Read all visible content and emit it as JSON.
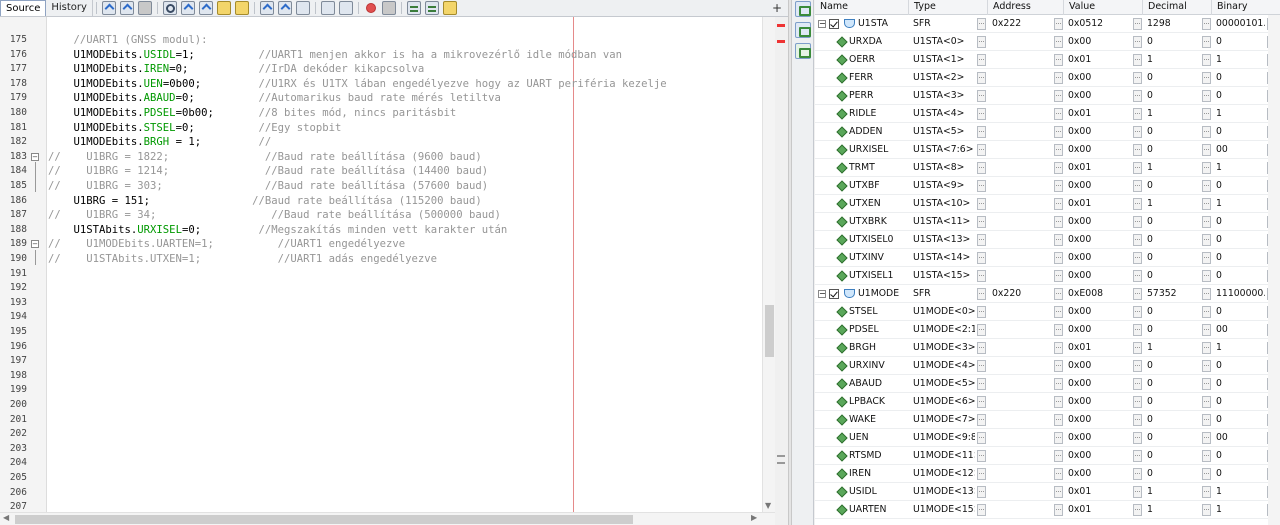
{
  "editor": {
    "tabs": [
      {
        "label": "Source",
        "active": true
      },
      {
        "label": "History",
        "active": false
      }
    ],
    "lines": [
      {
        "n": "175",
        "seg": [
          [
            "",
            "    "
          ],
          [
            "cm",
            "//UART1 (GNSS modul):"
          ]
        ]
      },
      {
        "n": "176",
        "seg": [
          [
            "",
            "    U1MODEbits."
          ],
          [
            "fld",
            "USIDL"
          ],
          [
            "",
            "=1;          "
          ],
          [
            "cm",
            "//UART1 menjen akkor is ha a mikrovezérlő idle módban van"
          ]
        ]
      },
      {
        "n": "177",
        "seg": [
          [
            "",
            "    U1MODEbits."
          ],
          [
            "fld",
            "IREN"
          ],
          [
            "",
            "=0;           "
          ],
          [
            "cm",
            "//IrDA dekóder kikapcsolva"
          ]
        ]
      },
      {
        "n": "178",
        "seg": [
          [
            "",
            "    U1MODEbits."
          ],
          [
            "fld",
            "UEN"
          ],
          [
            "",
            "=0b00;         "
          ],
          [
            "cm",
            "//U1RX és U1TX lában engedélyezve hogy az UART periféria kezelje"
          ]
        ]
      },
      {
        "n": "179",
        "seg": [
          [
            "",
            "    U1MODEbits."
          ],
          [
            "fld",
            "ABAUD"
          ],
          [
            "",
            "=0;          "
          ],
          [
            "cm",
            "//Automarikus baud rate mérés letiltva"
          ]
        ]
      },
      {
        "n": "180",
        "seg": [
          [
            "",
            "    U1MODEbits."
          ],
          [
            "fld",
            "PDSEL"
          ],
          [
            "",
            "=0b00;       "
          ],
          [
            "cm",
            "//8 bites mód, nincs paritásbit"
          ]
        ]
      },
      {
        "n": "181",
        "seg": [
          [
            "",
            "    U1MODEbits."
          ],
          [
            "fld",
            "STSEL"
          ],
          [
            "",
            "=0;          "
          ],
          [
            "cm",
            "//Egy stopbit"
          ]
        ]
      },
      {
        "n": "182",
        "seg": [
          [
            "",
            "    U1MODEbits."
          ],
          [
            "fld",
            "BRGH"
          ],
          [
            "",
            " = 1;         "
          ],
          [
            "cm",
            "//"
          ]
        ]
      },
      {
        "n": "183",
        "seg": [
          [
            "cm",
            "//    U1BRG = 1822;               //Baud rate beállítása (9600 baud)"
          ]
        ]
      },
      {
        "n": "184",
        "seg": [
          [
            "cm",
            "//    U1BRG = 1214;               //Baud rate beállítása (14400 baud)"
          ]
        ]
      },
      {
        "n": "185",
        "seg": [
          [
            "cm",
            "//    U1BRG = 303;                //Baud rate beállítása (57600 baud)"
          ]
        ]
      },
      {
        "n": "186",
        "seg": [
          [
            "",
            "    U1BRG = 151;                "
          ],
          [
            "cm",
            "//Baud rate beállítása (115200 baud)"
          ]
        ]
      },
      {
        "n": "187",
        "seg": [
          [
            "cm",
            "//    U1BRG = 34;                  //Baud rate beállítása (500000 baud)"
          ]
        ]
      },
      {
        "n": "188",
        "seg": [
          [
            "",
            "    U1STAbits."
          ],
          [
            "fld",
            "URXISEL"
          ],
          [
            "",
            "=0;         "
          ],
          [
            "cm",
            "//Megszakítás minden vett karakter után"
          ]
        ]
      },
      {
        "n": "189",
        "seg": [
          [
            "cm",
            "//    U1MODEbits.UARTEN=1;          //UART1 engedélyezve"
          ]
        ]
      },
      {
        "n": "190",
        "seg": [
          [
            "cm",
            "//    U1STAbits.UTXEN=1;            //UART1 adás engedélyezve"
          ]
        ]
      },
      {
        "n": "191",
        "seg": [
          [
            "",
            ""
          ]
        ]
      },
      {
        "n": "192",
        "seg": [
          [
            "",
            ""
          ]
        ]
      },
      {
        "n": "193",
        "seg": [
          [
            "",
            ""
          ]
        ]
      },
      {
        "n": "194",
        "seg": [
          [
            "",
            ""
          ]
        ]
      },
      {
        "n": "195",
        "seg": [
          [
            "",
            ""
          ]
        ]
      },
      {
        "n": "196",
        "seg": [
          [
            "",
            ""
          ]
        ]
      },
      {
        "n": "197",
        "seg": [
          [
            "",
            ""
          ]
        ]
      },
      {
        "n": "198",
        "seg": [
          [
            "",
            ""
          ]
        ]
      },
      {
        "n": "199",
        "seg": [
          [
            "",
            ""
          ]
        ]
      },
      {
        "n": "200",
        "seg": [
          [
            "",
            ""
          ]
        ]
      },
      {
        "n": "201",
        "seg": [
          [
            "",
            ""
          ]
        ]
      },
      {
        "n": "202",
        "seg": [
          [
            "",
            ""
          ]
        ]
      },
      {
        "n": "203",
        "seg": [
          [
            "",
            ""
          ]
        ]
      },
      {
        "n": "204",
        "seg": [
          [
            "",
            ""
          ]
        ]
      },
      {
        "n": "205",
        "seg": [
          [
            "",
            ""
          ]
        ]
      },
      {
        "n": "206",
        "seg": [
          [
            "",
            ""
          ]
        ]
      },
      {
        "n": "207",
        "seg": [
          [
            "",
            ""
          ]
        ]
      }
    ]
  },
  "watch": {
    "columns": [
      "Name",
      "Type",
      "Address",
      "Value",
      "Decimal",
      "Binary"
    ],
    "rows": [
      {
        "kind": "sfr",
        "name": "U1STA",
        "type": "SFR",
        "address": "0x222",
        "value": "0x0512",
        "decimal": "1298",
        "binary": "00000101..."
      },
      {
        "kind": "bit",
        "name": "URXDA",
        "type": "U1STA<0>",
        "address": "",
        "value": "0x00",
        "decimal": "0",
        "binary": "0"
      },
      {
        "kind": "bit",
        "name": "OERR",
        "type": "U1STA<1>",
        "address": "",
        "value": "0x01",
        "decimal": "1",
        "binary": "1"
      },
      {
        "kind": "bit",
        "name": "FERR",
        "type": "U1STA<2>",
        "address": "",
        "value": "0x00",
        "decimal": "0",
        "binary": "0"
      },
      {
        "kind": "bit",
        "name": "PERR",
        "type": "U1STA<3>",
        "address": "",
        "value": "0x00",
        "decimal": "0",
        "binary": "0"
      },
      {
        "kind": "bit",
        "name": "RIDLE",
        "type": "U1STA<4>",
        "address": "",
        "value": "0x01",
        "decimal": "1",
        "binary": "1"
      },
      {
        "kind": "bit",
        "name": "ADDEN",
        "type": "U1STA<5>",
        "address": "",
        "value": "0x00",
        "decimal": "0",
        "binary": "0"
      },
      {
        "kind": "bit",
        "name": "URXISEL",
        "type": "U1STA<7:6>",
        "address": "",
        "value": "0x00",
        "decimal": "0",
        "binary": "00"
      },
      {
        "kind": "bit",
        "name": "TRMT",
        "type": "U1STA<8>",
        "address": "",
        "value": "0x01",
        "decimal": "1",
        "binary": "1"
      },
      {
        "kind": "bit",
        "name": "UTXBF",
        "type": "U1STA<9>",
        "address": "",
        "value": "0x00",
        "decimal": "0",
        "binary": "0"
      },
      {
        "kind": "bit",
        "name": "UTXEN",
        "type": "U1STA<10>",
        "address": "",
        "value": "0x01",
        "decimal": "1",
        "binary": "1"
      },
      {
        "kind": "bit",
        "name": "UTXBRK",
        "type": "U1STA<11>",
        "address": "",
        "value": "0x00",
        "decimal": "0",
        "binary": "0"
      },
      {
        "kind": "bit",
        "name": "UTXISEL0",
        "type": "U1STA<13>",
        "address": "",
        "value": "0x00",
        "decimal": "0",
        "binary": "0"
      },
      {
        "kind": "bit",
        "name": "UTXINV",
        "type": "U1STA<14>",
        "address": "",
        "value": "0x00",
        "decimal": "0",
        "binary": "0"
      },
      {
        "kind": "bit",
        "name": "UTXISEL1",
        "type": "U1STA<15>",
        "address": "",
        "value": "0x00",
        "decimal": "0",
        "binary": "0"
      },
      {
        "kind": "sfr",
        "name": "U1MODE",
        "type": "SFR",
        "address": "0x220",
        "value": "0xE008",
        "decimal": "57352",
        "binary": "11100000..."
      },
      {
        "kind": "bit",
        "name": "STSEL",
        "type": "U1MODE<0>",
        "address": "",
        "value": "0x00",
        "decimal": "0",
        "binary": "0"
      },
      {
        "kind": "bit",
        "name": "PDSEL",
        "type": "U1MODE<2:1...",
        "address": "",
        "value": "0x00",
        "decimal": "0",
        "binary": "00"
      },
      {
        "kind": "bit",
        "name": "BRGH",
        "type": "U1MODE<3>",
        "address": "",
        "value": "0x01",
        "decimal": "1",
        "binary": "1"
      },
      {
        "kind": "bit",
        "name": "URXINV",
        "type": "U1MODE<4>",
        "address": "",
        "value": "0x00",
        "decimal": "0",
        "binary": "0"
      },
      {
        "kind": "bit",
        "name": "ABAUD",
        "type": "U1MODE<5>",
        "address": "",
        "value": "0x00",
        "decimal": "0",
        "binary": "0"
      },
      {
        "kind": "bit",
        "name": "LPBACK",
        "type": "U1MODE<6>",
        "address": "",
        "value": "0x00",
        "decimal": "0",
        "binary": "0"
      },
      {
        "kind": "bit",
        "name": "WAKE",
        "type": "U1MODE<7>",
        "address": "",
        "value": "0x00",
        "decimal": "0",
        "binary": "0"
      },
      {
        "kind": "bit",
        "name": "UEN",
        "type": "U1MODE<9:8...",
        "address": "",
        "value": "0x00",
        "decimal": "0",
        "binary": "00"
      },
      {
        "kind": "bit",
        "name": "RTSMD",
        "type": "U1MODE<11>",
        "address": "",
        "value": "0x00",
        "decimal": "0",
        "binary": "0"
      },
      {
        "kind": "bit",
        "name": "IREN",
        "type": "U1MODE<12>",
        "address": "",
        "value": "0x00",
        "decimal": "0",
        "binary": "0"
      },
      {
        "kind": "bit",
        "name": "USIDL",
        "type": "U1MODE<13>",
        "address": "",
        "value": "0x01",
        "decimal": "1",
        "binary": "1"
      },
      {
        "kind": "bit",
        "name": "UARTEN",
        "type": "U1MODE<15>",
        "address": "",
        "value": "0x01",
        "decimal": "1",
        "binary": "1"
      }
    ]
  }
}
